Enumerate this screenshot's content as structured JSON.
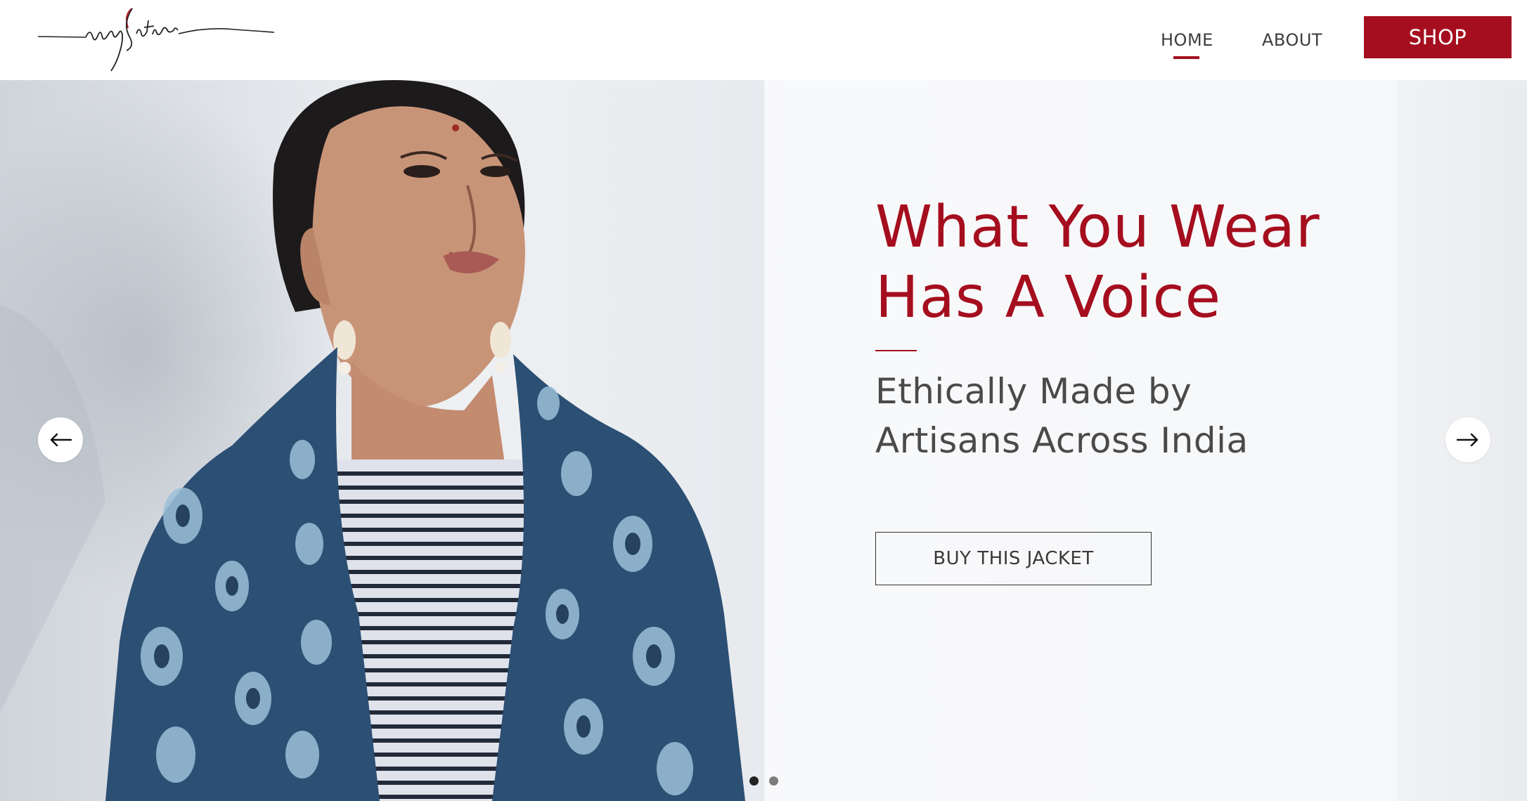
{
  "header": {
    "logo_alt": "rangSutra",
    "nav": [
      {
        "label": "HOME",
        "active": true
      },
      {
        "label": "ABOUT",
        "active": false
      }
    ],
    "shop_label": "SHOP"
  },
  "hero": {
    "headline_lines": [
      "What You Wear",
      "Has A Voice"
    ],
    "subline_lines": [
      "Ethically Made by",
      "Artisans Across India"
    ],
    "cta_label": "BUY THIS JACKET",
    "prev_icon": "arrow-left-icon",
    "next_icon": "arrow-right-icon",
    "slides_total": 2,
    "active_slide": 1,
    "image": "woman wearing blue block-print jacket over striped top"
  },
  "colors": {
    "brand_red": "#a50e1e",
    "text_dark": "#3d3d3d",
    "dot_active": "#222222",
    "dot_inactive": "#7c7c7c"
  }
}
